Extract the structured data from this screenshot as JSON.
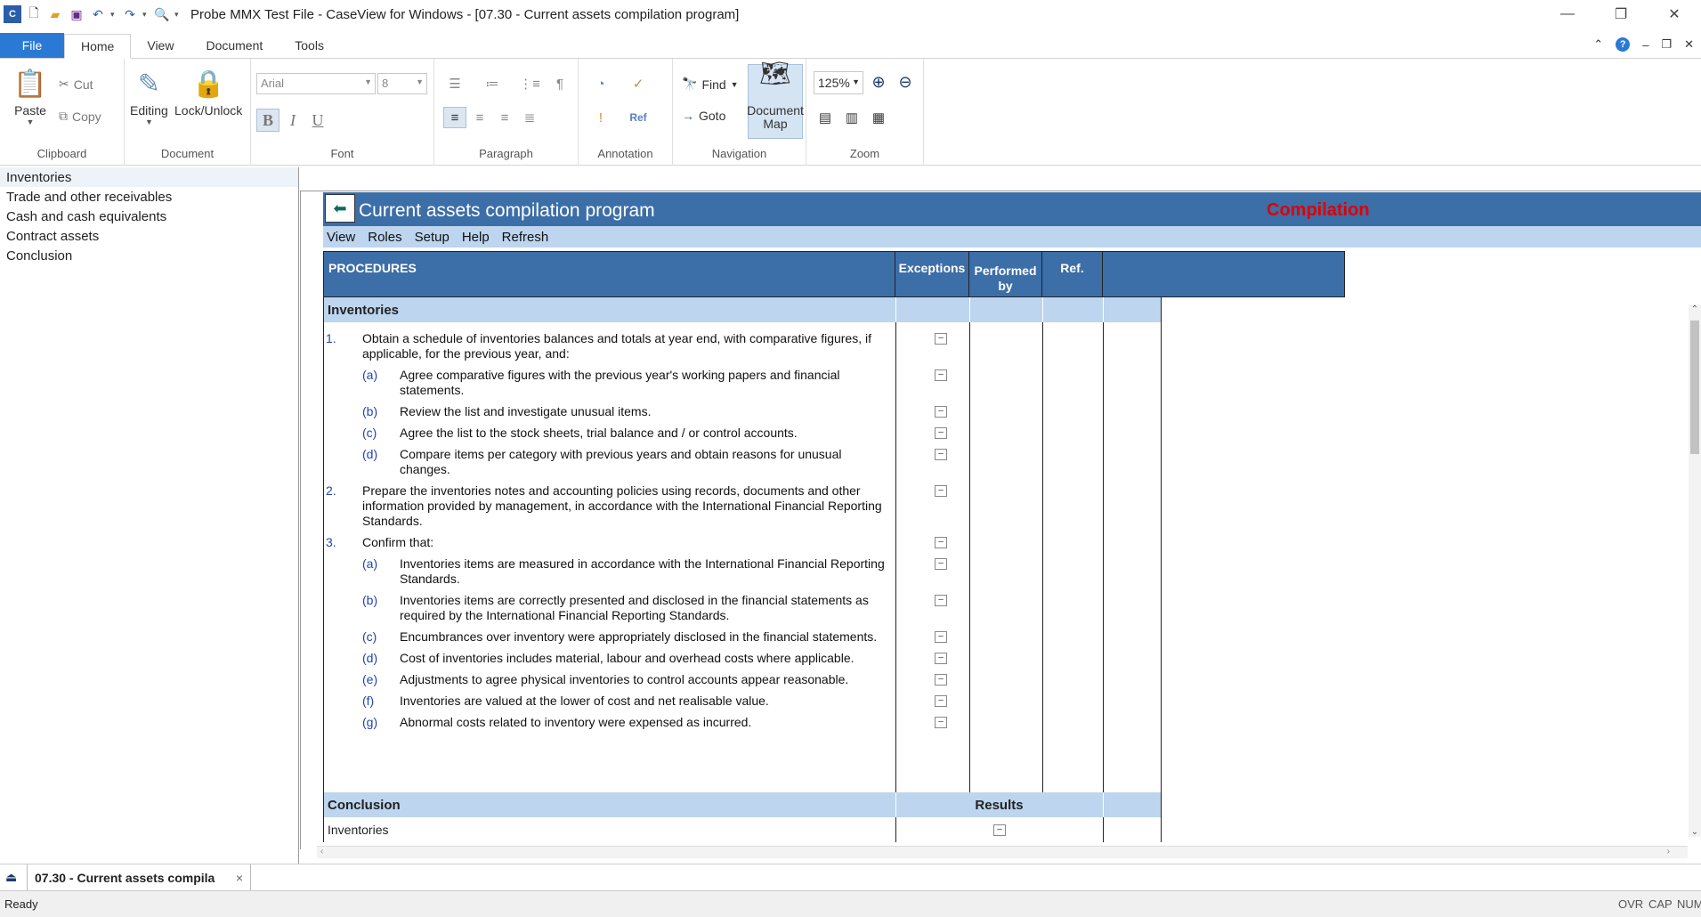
{
  "window": {
    "title": "Probe MMX Test File - CaseView for Windows - [07.30 - Current assets compilation program]",
    "controls": {
      "minimize": "—",
      "restore": "❐",
      "close": "✕"
    }
  },
  "ribbon_tabs": [
    "File",
    "Home",
    "View",
    "Document",
    "Tools"
  ],
  "ribbon": {
    "clipboard": {
      "paste": "Paste",
      "cut": "Cut",
      "copy": "Copy",
      "label": "Clipboard"
    },
    "document": {
      "editing": "Editing",
      "lock": "Lock/Unlock",
      "label": "Document"
    },
    "font": {
      "family": "Arial",
      "size": "8",
      "bold": "B",
      "italic": "I",
      "underline": "U",
      "label": "Font"
    },
    "paragraph": {
      "label": "Paragraph"
    },
    "annotation": {
      "label": "Annotation"
    },
    "navigation": {
      "find": "Find",
      "goto": "Goto",
      "document_map_line1": "Document",
      "document_map_line2": "Map",
      "label": "Navigation"
    },
    "zoom": {
      "level": "125%",
      "label": "Zoom"
    }
  },
  "nav_pane": {
    "items": [
      "Inventories",
      "Trade and other receivables",
      "Cash and cash equivalents",
      "Contract assets",
      "Conclusion"
    ],
    "selected": "Inventories"
  },
  "form": {
    "title": "Current assets compilation program",
    "stage": "Compilation",
    "menu": [
      "View",
      "Roles",
      "Setup",
      "Help",
      "Refresh"
    ],
    "columns": {
      "procedures": "PROCEDURES",
      "exceptions": "Exceptions",
      "performed_by_1": "Performed",
      "performed_by_2": "by",
      "ref": "Ref."
    },
    "section": "Inventories",
    "procedures": [
      {
        "num": "1.",
        "level": 0,
        "l1": "Obtain a schedule of inventories balances and totals at year end, with comparative figures, if",
        "l2": "applicable, for the previous year, and:",
        "l3": ""
      },
      {
        "num": "(a)",
        "level": 1,
        "l1": "Agree comparative figures with the previous year's working papers and financial",
        "l2": "statements.",
        "l3": ""
      },
      {
        "num": "(b)",
        "level": 1,
        "l1": "Review the list and investigate unusual items.",
        "l2": "",
        "l3": ""
      },
      {
        "num": "(c)",
        "level": 1,
        "l1": "Agree the list to the stock sheets, trial balance and / or control accounts.",
        "l2": "",
        "l3": ""
      },
      {
        "num": "(d)",
        "level": 1,
        "l1": "Compare items per category with previous years and obtain reasons for unusual",
        "l2": "changes.",
        "l3": ""
      },
      {
        "num": "2.",
        "level": 0,
        "l1": "Prepare the inventories notes and accounting policies using records, documents and other",
        "l2": "information provided by management, in accordance with the International Financial Reporting",
        "l3": "Standards."
      },
      {
        "num": "3.",
        "level": 0,
        "l1": "Confirm that:",
        "l2": "",
        "l3": ""
      },
      {
        "num": "(a)",
        "level": 1,
        "l1": "Inventories items are measured in accordance with the International Financial Reporting",
        "l2": "Standards.",
        "l3": ""
      },
      {
        "num": "(b)",
        "level": 1,
        "l1": "Inventories items are correctly presented and disclosed in the financial statements as",
        "l2": "required by the International Financial Reporting Standards.",
        "l3": ""
      },
      {
        "num": "(c)",
        "level": 1,
        "l1": "Encumbrances over inventory were appropriately disclosed in the financial statements.",
        "l2": "",
        "l3": ""
      },
      {
        "num": "(d)",
        "level": 1,
        "l1": "Cost of inventories includes material, labour and overhead costs where applicable.",
        "l2": "",
        "l3": ""
      },
      {
        "num": "(e)",
        "level": 1,
        "l1": "Adjustments to agree physical inventories to control accounts appear reasonable.",
        "l2": "",
        "l3": ""
      },
      {
        "num": "(f)",
        "level": 1,
        "l1": "Inventories are valued at the lower of cost and net realisable value.",
        "l2": "",
        "l3": ""
      },
      {
        "num": "(g)",
        "level": 1,
        "l1": "Abnormal costs related to inventory were expensed as incurred.",
        "l2": "",
        "l3": ""
      }
    ],
    "exception_mark": "–",
    "conclusion": {
      "label": "Conclusion",
      "results": "Results",
      "row": "Inventories"
    }
  },
  "doc_tab": {
    "label": "07.30 - Current assets compila",
    "close": "×"
  },
  "status": {
    "text": "Ready",
    "ovr": "OVR",
    "cap": "CAP",
    "num": "NUM"
  }
}
